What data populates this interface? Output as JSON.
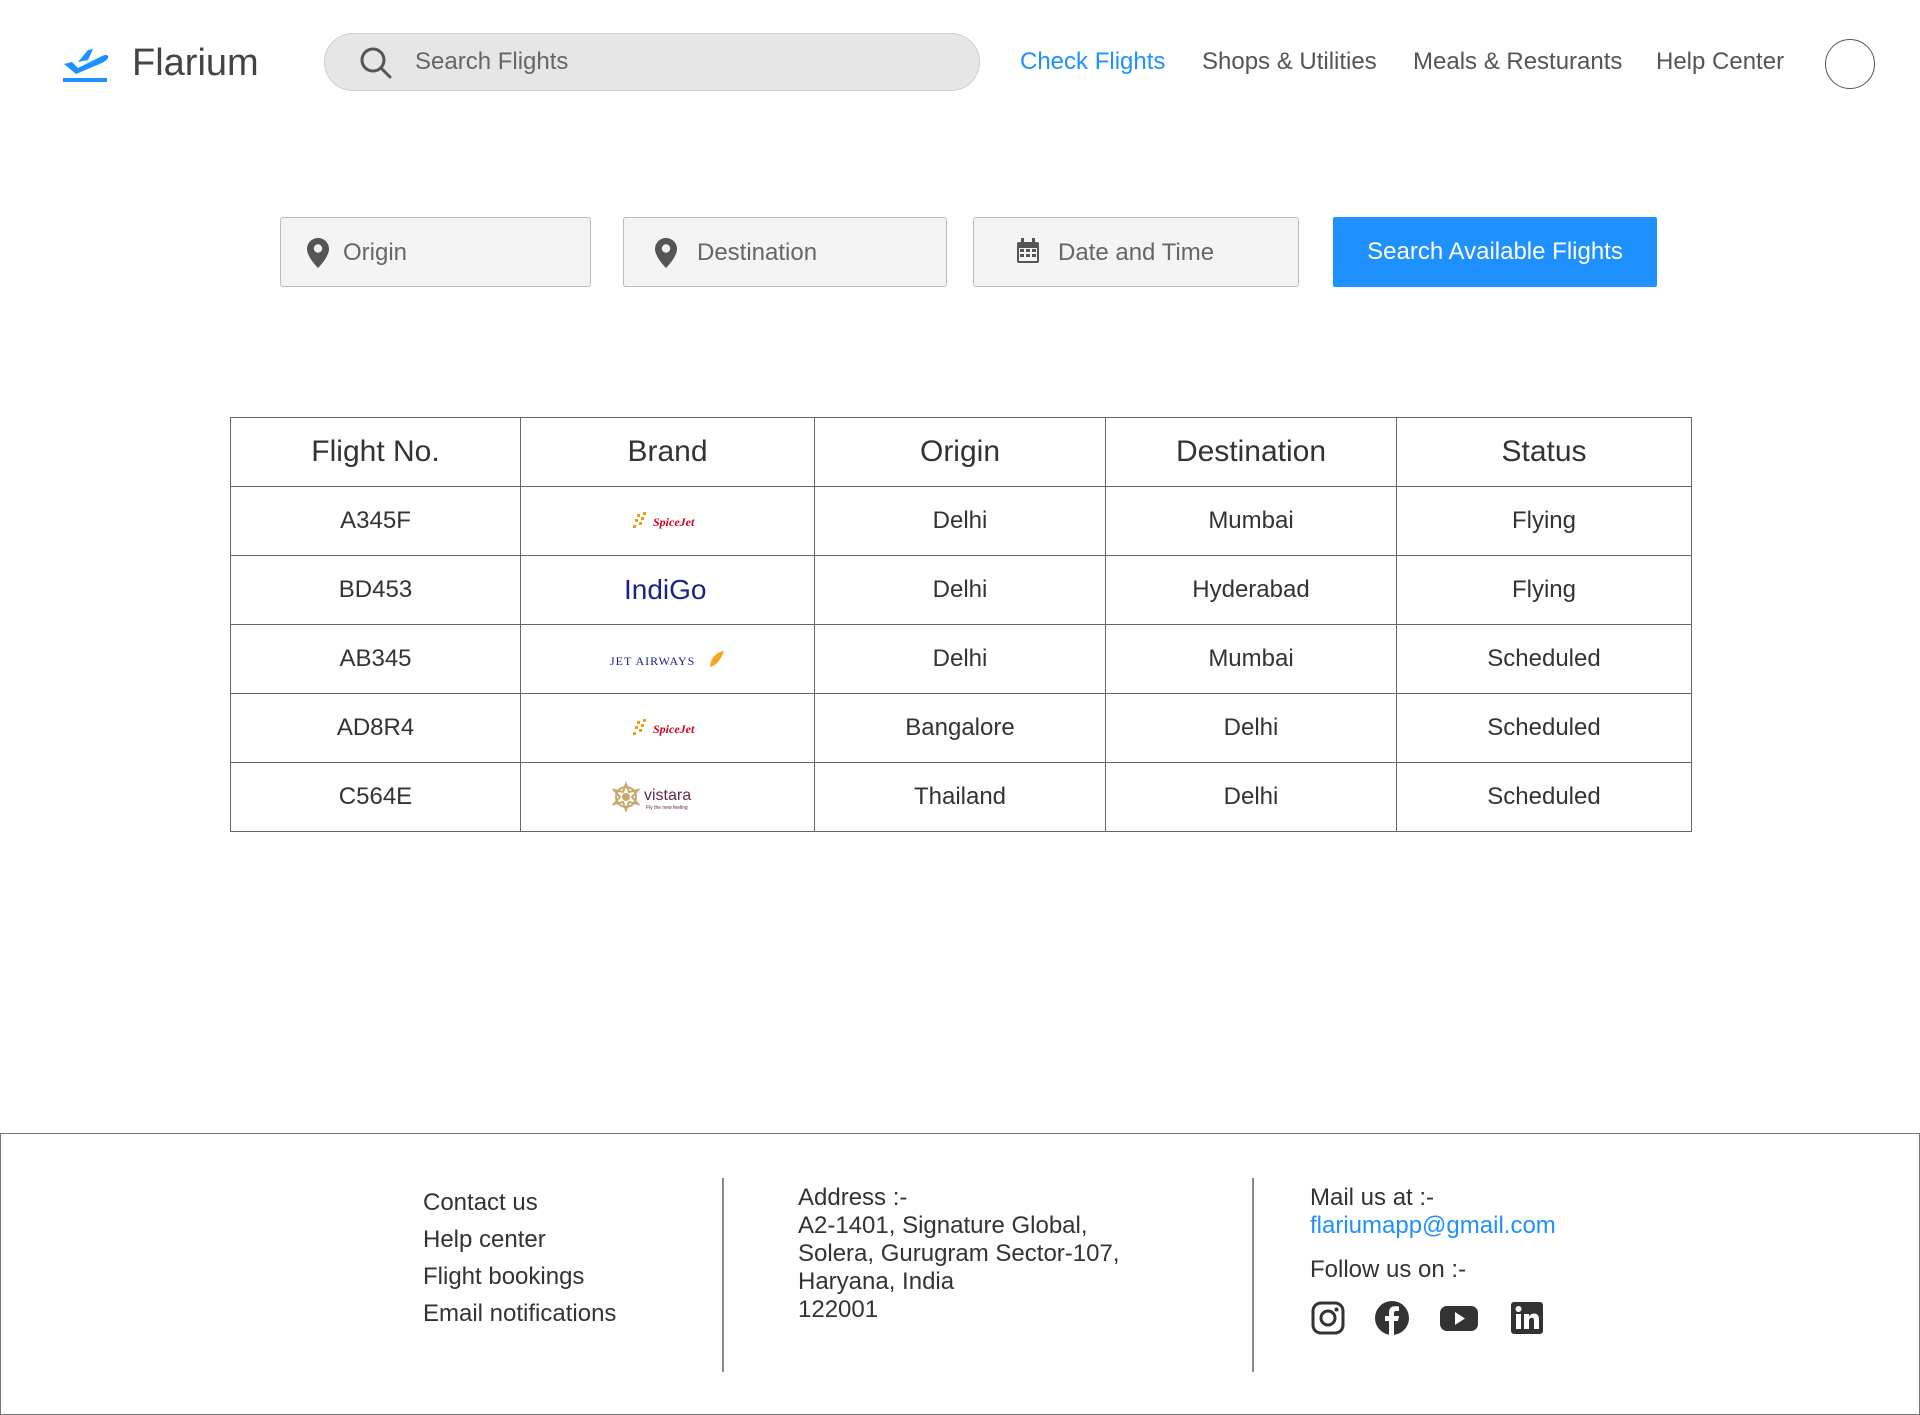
{
  "header": {
    "app_name": "Flarium",
    "search": {
      "placeholder": "Search Flights"
    },
    "nav": [
      {
        "label": "Check Flights",
        "active": true
      },
      {
        "label": "Shops & Utilities",
        "active": false
      },
      {
        "label": "Meals & Resturants",
        "active": false
      },
      {
        "label": "Help Center",
        "active": false
      }
    ],
    "accent_color": "#1e90ff"
  },
  "search_form": {
    "origin_placeholder": "Origin",
    "destination_placeholder": "Destination",
    "date_placeholder": "Date and Time",
    "button_label": "Search Available Flights"
  },
  "flights_table": {
    "headers": [
      "Flight No.",
      "Brand",
      "Origin",
      "Destination",
      "Status"
    ],
    "rows": [
      {
        "flight_no": "A345F",
        "brand": "SpiceJet",
        "origin": "Delhi",
        "destination": "Mumbai",
        "status": "Flying"
      },
      {
        "flight_no": "BD453",
        "brand": "IndiGo",
        "origin": "Delhi",
        "destination": "Hyderabad",
        "status": "Flying"
      },
      {
        "flight_no": "AB345",
        "brand": "JET AIRWAYS",
        "origin": "Delhi",
        "destination": "Mumbai",
        "status": "Scheduled"
      },
      {
        "flight_no": "AD8R4",
        "brand": "SpiceJet",
        "origin": "Bangalore",
        "destination": "Delhi",
        "status": "Scheduled"
      },
      {
        "flight_no": "C564E",
        "brand": "vistara",
        "brand_tagline": "Fly the new feeling",
        "origin": "Thailand",
        "destination": "Delhi",
        "status": "Scheduled"
      }
    ]
  },
  "footer": {
    "links": [
      "Contact us",
      "Help center",
      "Flight bookings",
      "Email notifications"
    ],
    "address_title": "Address :-",
    "address_lines": [
      "A2-1401, Signature Global,",
      "Solera, Gurugram Sector-107,",
      "Haryana, India",
      "122001"
    ],
    "mail_title": "Mail us at :-",
    "email": "flariumapp@gmail.com",
    "follow_title": "Follow us on :-",
    "social_icons": [
      "instagram-icon",
      "facebook-icon",
      "youtube-icon",
      "linkedin-icon"
    ]
  }
}
